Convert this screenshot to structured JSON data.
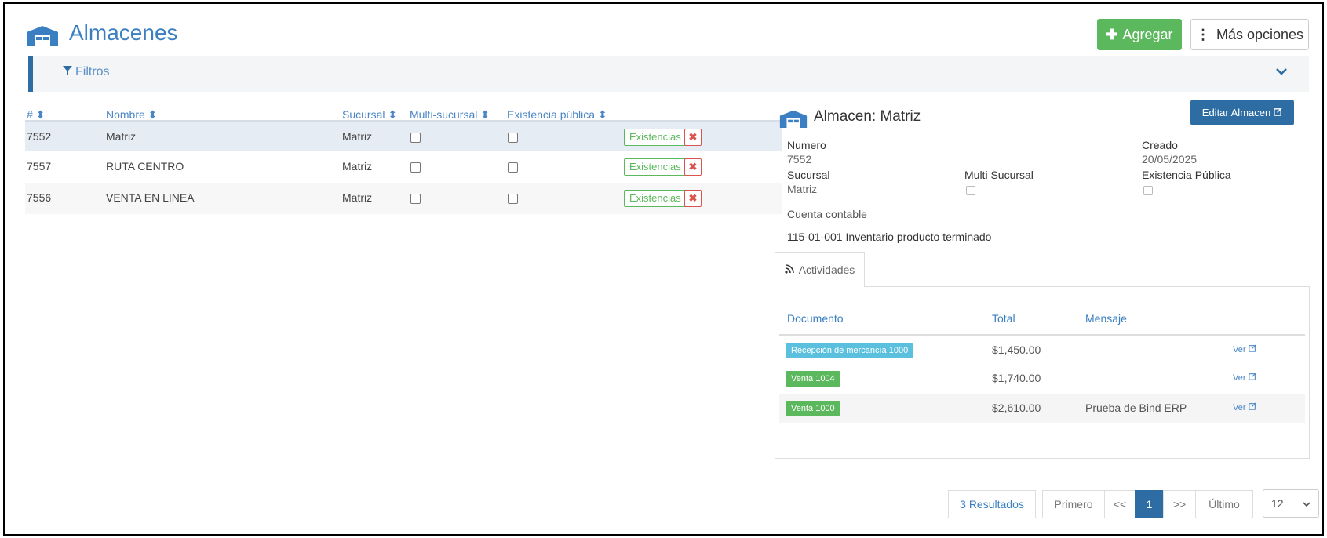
{
  "header": {
    "title": "Almacenes",
    "add_label": "Agregar",
    "more_label": "Más opciones"
  },
  "filters": {
    "label": "Filtros"
  },
  "table": {
    "columns": [
      "#",
      "Nombre",
      "Sucursal",
      "Multi-sucursal",
      "Existencia pública"
    ],
    "rows": [
      {
        "id": "7552",
        "name": "Matriz",
        "branch": "Matriz",
        "multi": false,
        "public": false,
        "action": "Existencias"
      },
      {
        "id": "7557",
        "name": "RUTA CENTRO",
        "branch": "Matriz",
        "multi": false,
        "public": false,
        "action": "Existencias"
      },
      {
        "id": "7556",
        "name": "VENTA EN LINEA",
        "branch": "Matriz",
        "multi": false,
        "public": false,
        "action": "Existencias"
      }
    ]
  },
  "detail": {
    "title": "Almacen: Matriz",
    "edit_label": "Editar Almacen",
    "numero_label": "Numero",
    "numero_value": "7552",
    "creado_label": "Creado",
    "creado_value": "20/05/2025",
    "sucursal_label": "Sucursal",
    "sucursal_value": "Matriz",
    "multi_label": "Multi Sucursal",
    "existencia_label": "Existencia Pública",
    "cuenta_label": "Cuenta contable",
    "cuenta_value": "115-01-001 Inventario producto terminado"
  },
  "activities": {
    "tab_label": "Actividades",
    "columns": [
      "Documento",
      "Total",
      "Mensaje"
    ],
    "rows": [
      {
        "doc": "Recepción de mercancía 1000",
        "color": "#5bc0de",
        "total": "$1,450.00",
        "msg": "",
        "link": "Ver"
      },
      {
        "doc": "Venta 1004",
        "color": "#5cb85c",
        "total": "$1,740.00",
        "msg": "",
        "link": "Ver"
      },
      {
        "doc": "Venta 1000",
        "color": "#5cb85c",
        "total": "$2,610.00",
        "msg": "Prueba de Bind ERP",
        "link": "Ver"
      }
    ]
  },
  "pagination": {
    "results": "3 Resultados",
    "first": "Primero",
    "prev": "<<",
    "current": "1",
    "next": ">>",
    "last": "Último",
    "page_size": "12"
  },
  "colors": {
    "primary": "#2e6da4",
    "success": "#5cb85c",
    "danger": "#d9534f",
    "info": "#5bc0de"
  }
}
